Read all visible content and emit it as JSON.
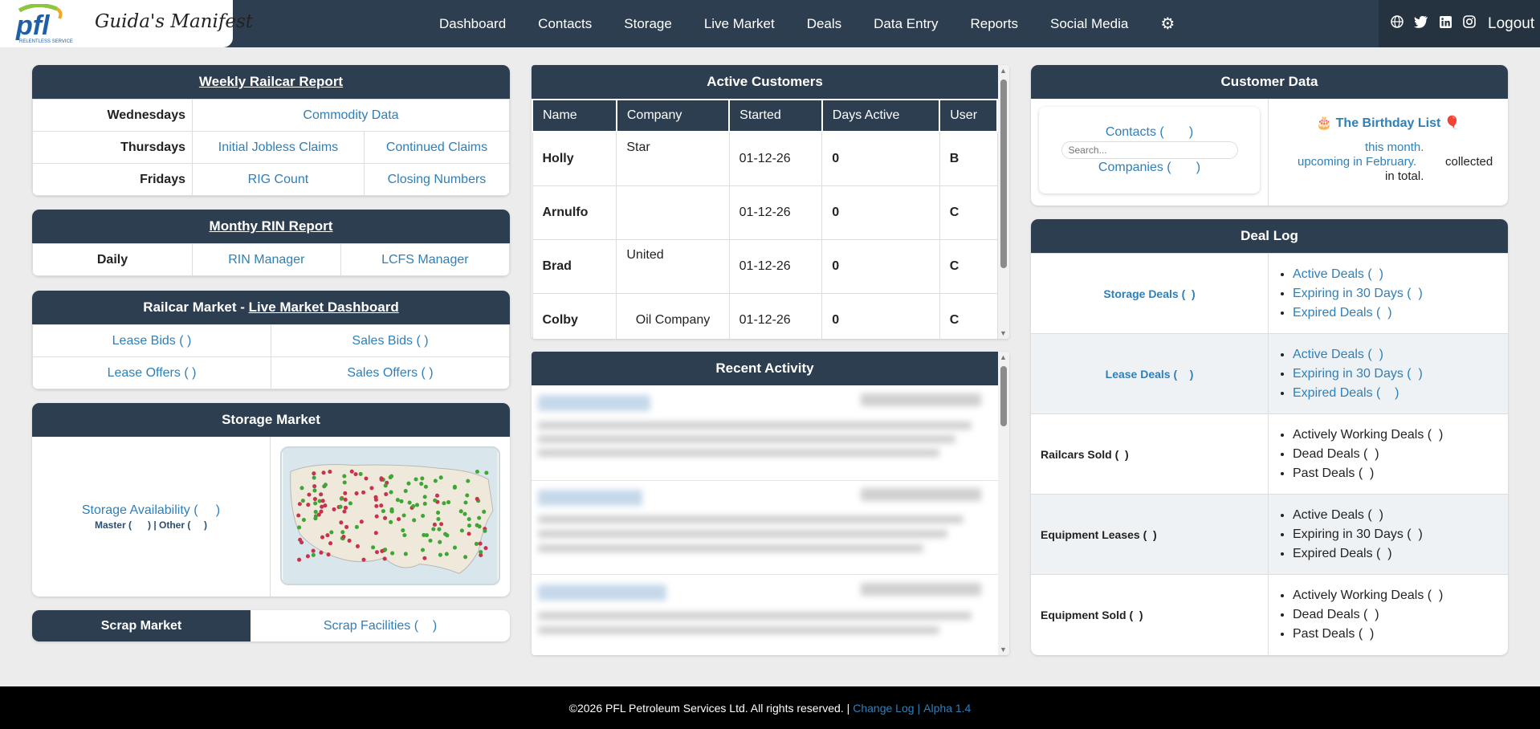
{
  "brand": {
    "logo_text": "pfl",
    "logo_tagline": "RELENTLESS SERVICE",
    "title": "Guida's Manifest"
  },
  "nav": [
    "Dashboard",
    "Contacts",
    "Storage",
    "Live Market",
    "Deals",
    "Data Entry",
    "Reports",
    "Social Media"
  ],
  "header": {
    "logout": "Logout"
  },
  "weekly_railcar": {
    "title": "Weekly Railcar Report",
    "rows": [
      {
        "day": "Wednesdays",
        "links": [
          "Commodity Data"
        ]
      },
      {
        "day": "Thursdays",
        "links": [
          "Initial Jobless Claims",
          "Continued Claims"
        ]
      },
      {
        "day": "Fridays",
        "links": [
          "RIG Count",
          "Closing Numbers"
        ]
      }
    ]
  },
  "rin_report": {
    "title": "Monthy RIN Report",
    "label": "Daily",
    "links": [
      "RIN Manager",
      "LCFS Manager"
    ]
  },
  "railcar_market": {
    "title_prefix": "Railcar Market - ",
    "title_link": "Live Market Dashboard",
    "cells": [
      "Lease Bids (  )",
      "Sales Bids (  )",
      "Lease Offers (   )",
      "Sales Offers (   )"
    ]
  },
  "storage_market": {
    "title": "Storage Market",
    "availability": "Storage Availability (     )",
    "sub": "Master (      ) | Other (     )"
  },
  "scrap_market": {
    "title": "Scrap Market",
    "link": "Scrap Facilities (    )"
  },
  "active_customers": {
    "title": "Active Customers",
    "columns": [
      "Name",
      "Company",
      "Started",
      "Days Active",
      "User"
    ],
    "rows": [
      {
        "name": "Holly",
        "company": "Star",
        "started": "01-12-26",
        "days": "0",
        "user": "B"
      },
      {
        "name": "Arnulfo",
        "company": "",
        "started": "01-12-26",
        "days": "0",
        "user": "C"
      },
      {
        "name": "Brad",
        "company": "United",
        "started": "01-12-26",
        "days": "0",
        "user": "C"
      },
      {
        "name": "Colby",
        "company": "Oil Company",
        "started": "01-12-26",
        "days": "0",
        "user": "C"
      }
    ]
  },
  "recent_activity": {
    "title": "Recent Activity"
  },
  "customer_data": {
    "title": "Customer Data",
    "contacts": "Contacts (       )",
    "search_placeholder": "Search...",
    "companies": "Companies (       )",
    "birthday_title": "The Birthday List",
    "birthday_line1": "this month.",
    "birthday_line2": "upcoming in February.",
    "birthday_collected": "collected",
    "birthday_line3": "in total."
  },
  "deal_log": {
    "title": "Deal Log",
    "rows": [
      {
        "label": "Storage Deals (  )",
        "linked": true,
        "items": [
          "Active Deals (  )",
          "Expiring in 30 Days (  )",
          "Expired Deals (  )"
        ]
      },
      {
        "label": "Lease Deals (    )",
        "linked": true,
        "items": [
          "Active Deals (  )",
          "Expiring in 30 Days (  )",
          "Expired Deals (    )"
        ]
      },
      {
        "label": "Railcars Sold (  )",
        "linked": false,
        "items": [
          "Actively Working Deals (  )",
          "Dead Deals (  )",
          "Past Deals (  )"
        ]
      },
      {
        "label": "Equipment Leases (  )",
        "linked": false,
        "items": [
          "Active Deals (  )",
          "Expiring in 30 Days (  )",
          "Expired Deals (  )"
        ]
      },
      {
        "label": "Equipment Sold (  )",
        "linked": false,
        "items": [
          "Actively Working Deals (  )",
          "Dead Deals (  )",
          "Past Deals (  )"
        ]
      }
    ]
  },
  "footer": {
    "copyright": "©2026 PFL Petroleum Services Ltd. All rights reserved. |",
    "change_log": "Change Log",
    "sep": "|",
    "version": "Alpha 1.4"
  },
  "colors": {
    "navy": "#2c3e50",
    "link": "#2f7fb8"
  }
}
